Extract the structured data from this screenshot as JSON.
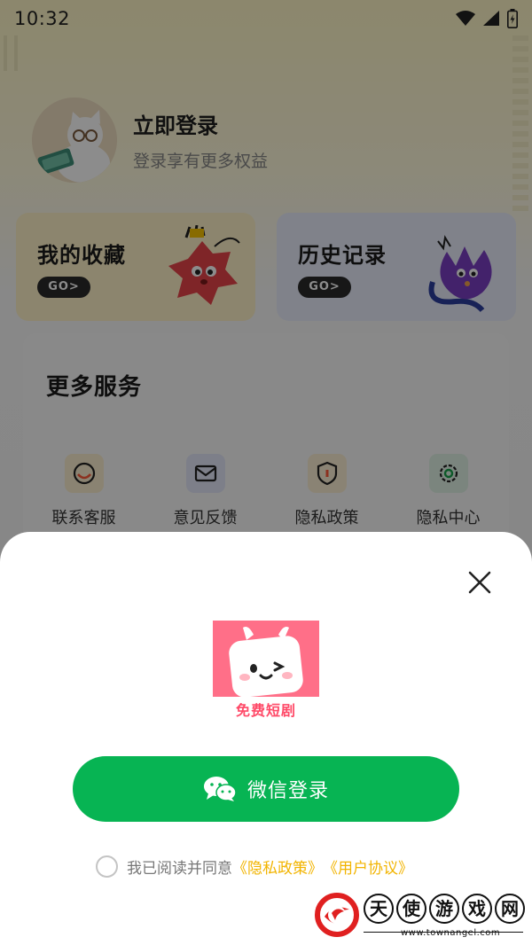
{
  "status_bar": {
    "time": "10:32",
    "icons": [
      "wifi-icon",
      "signal-icon",
      "battery-icon"
    ]
  },
  "profile": {
    "title": "立即登录",
    "subtitle": "登录享有更多权益"
  },
  "cards": [
    {
      "title": "我的收藏",
      "go": "GO>"
    },
    {
      "title": "历史记录",
      "go": "GO>"
    }
  ],
  "services": {
    "title": "更多服务",
    "items": [
      {
        "label": "联系客服",
        "icon": "headset-icon"
      },
      {
        "label": "意见反馈",
        "icon": "mail-icon"
      },
      {
        "label": "隐私政策",
        "icon": "shield-icon"
      },
      {
        "label": "隐私中心",
        "icon": "gear-icon"
      }
    ]
  },
  "login_sheet": {
    "logo_caption": "免费短剧",
    "wechat_button": "微信登录",
    "agreement_prefix": "我已阅读并同意",
    "privacy_link": "《隐私政策》",
    "user_link": "《用户协议》"
  },
  "watermark": {
    "chars": [
      "天",
      "使",
      "游",
      "戏",
      "网"
    ],
    "url": "www.townangel.com"
  },
  "colors": {
    "wechat_green": "#07b453",
    "link_yellow": "#f2b400",
    "logo_pink": "#ff6f88"
  }
}
